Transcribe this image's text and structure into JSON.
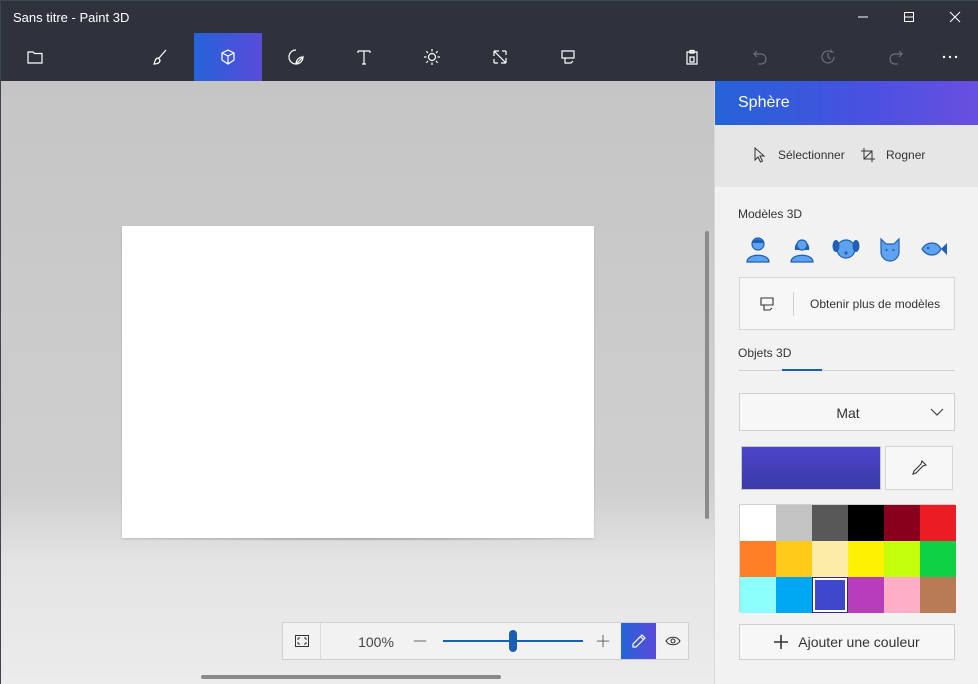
{
  "window": {
    "title": "Sans titre - Paint 3D"
  },
  "toolbar": {
    "items": [
      "folder-icon",
      "brush-icon",
      "cube-icon",
      "sticker-icon",
      "text-icon",
      "effects-icon",
      "resize-icon",
      "remix-icon",
      "paste-icon",
      "undo-icon",
      "history-icon",
      "redo-icon",
      "more-icon"
    ],
    "active": "cube-icon"
  },
  "zoom": {
    "percent": "100%",
    "level_fraction": 0.5
  },
  "panel": {
    "title": "Sphère",
    "select_label": "Sélectionner",
    "crop_label": "Rogner",
    "models_label": "Modèles 3D",
    "models": [
      "man-model-icon",
      "woman-model-icon",
      "dog-model-icon",
      "cat-model-icon",
      "fish-model-icon"
    ],
    "get_more_label": "Obtenir plus de modèles",
    "objects_tab_label": "Objets 3D",
    "finish_value": "Mat",
    "current_color": "#4040c0",
    "palette": [
      "#ffffff",
      "#c3c3c3",
      "#585858",
      "#000000",
      "#88001b",
      "#ec1c24",
      "#ff7f27",
      "#ffca18",
      "#fdeca6",
      "#fff200",
      "#c4ff0e",
      "#0ed145",
      "#8cfffb",
      "#00a8f3",
      "#3f48cc",
      "#b83dba",
      "#ffaec8",
      "#b97a56"
    ],
    "selected_index": 14,
    "add_color_label": "Ajouter une couleur"
  }
}
